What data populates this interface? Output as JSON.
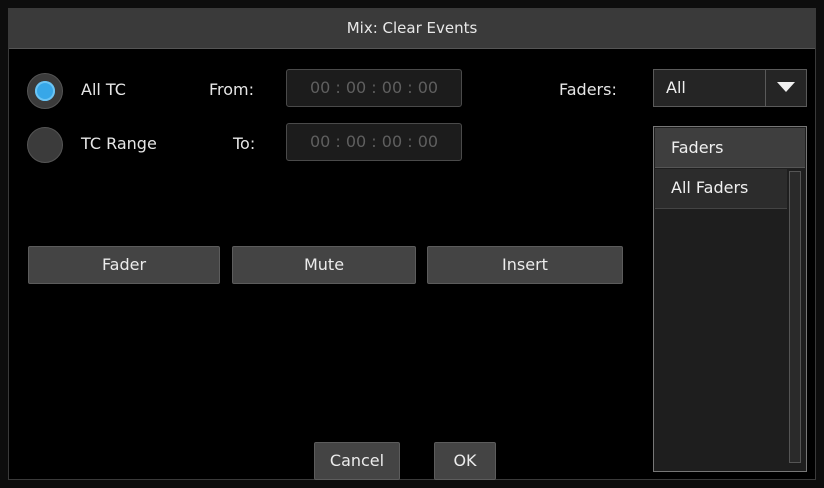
{
  "window": {
    "title": "Mix: Clear Events"
  },
  "range": {
    "all_tc_label": "All TC",
    "tc_range_label": "TC Range",
    "selected": "All TC"
  },
  "timecode": {
    "from_label": "From:",
    "to_label": "To:",
    "from_value": "00 : 00 : 00 : 00",
    "to_value": "00 : 00 : 00 : 00"
  },
  "faders": {
    "label": "Faders:",
    "dropdown_value": "All",
    "list_header": "Faders",
    "list_items": [
      "All Faders"
    ]
  },
  "event_buttons": [
    "Fader",
    "Mute",
    "Insert"
  ],
  "footer": {
    "cancel_label": "Cancel",
    "ok_label": "OK"
  },
  "colors": {
    "radio_selected": "#37a7e8",
    "background": "#000000",
    "titlebar": "#3a3a3a"
  }
}
